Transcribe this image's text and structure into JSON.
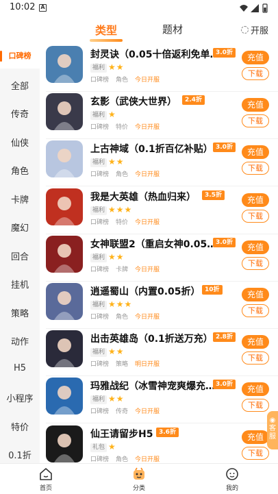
{
  "status_bar": {
    "time": "10:02",
    "notification_icon": "A"
  },
  "top_tabs": [
    {
      "label": "类型",
      "active": true
    },
    {
      "label": "题材",
      "active": false
    }
  ],
  "server_button": {
    "label": "开服",
    "icon": "refresh-ring-icon"
  },
  "sidebar": {
    "items": [
      {
        "label": "口碑榜",
        "active": true
      },
      {
        "label": "全部"
      },
      {
        "label": "传奇"
      },
      {
        "label": "仙侠"
      },
      {
        "label": "角色"
      },
      {
        "label": "卡牌"
      },
      {
        "label": "魔幻"
      },
      {
        "label": "回合"
      },
      {
        "label": "挂机"
      },
      {
        "label": "策略"
      },
      {
        "label": "动作"
      },
      {
        "label": "H5"
      },
      {
        "label": "小程序"
      },
      {
        "label": "特价"
      },
      {
        "label": "0.1折"
      }
    ]
  },
  "games": [
    {
      "name": "封灵诀（0.05十倍返利免单…",
      "discount": "3.0折",
      "badge": "福利",
      "stars": "★★",
      "rating": 1.5,
      "tags": [
        "口碑榜",
        "角色"
      ],
      "open": "今日开服",
      "charge_label": "充值",
      "download_label": "下载",
      "thumb_color": "#4a7fb0"
    },
    {
      "name": "玄影（武侠大世界）",
      "discount": "2.4折",
      "badge": "福利",
      "stars": "★",
      "rating": 0.5,
      "tags": [
        "口碑榜",
        "特价"
      ],
      "open": "今日开服",
      "charge_label": "充值",
      "download_label": "下载",
      "thumb_color": "#3a3a4a"
    },
    {
      "name": "上古神域（0.1折百亿补贴）",
      "discount": "3.0折",
      "badge": "福利",
      "stars": "★★",
      "rating": 1.5,
      "tags": [
        "口碑榜",
        "角色"
      ],
      "open": "今日开服",
      "charge_label": "充值",
      "download_label": "下载",
      "thumb_color": "#b8c6e0"
    },
    {
      "name": "我是大英雄（热血归来）",
      "discount": "3.5折",
      "badge": "福利",
      "stars": "★★★",
      "rating": 3,
      "tags": [
        "口碑榜",
        "特价"
      ],
      "open": "今日开服",
      "charge_label": "充值",
      "download_label": "下载",
      "thumb_color": "#c03020"
    },
    {
      "name": "女神联盟2（重启女神0.05…",
      "discount": "3.0折",
      "badge": "福利",
      "stars": "★★",
      "rating": 2,
      "tags": [
        "口碑榜",
        "卡牌"
      ],
      "open": "今日开服",
      "charge_label": "充值",
      "download_label": "下载",
      "thumb_color": "#8a2020"
    },
    {
      "name": "逍遥蜀山（内置0.05折）",
      "discount": "10折",
      "badge": "福利",
      "stars": "★★★",
      "rating": 3,
      "tags": [
        "口碑榜",
        "角色"
      ],
      "open": "今日开服",
      "charge_label": "充值",
      "download_label": "下载",
      "thumb_color": "#5a6a9a"
    },
    {
      "name": "出击英雄岛（0.1折送万充）",
      "discount": "2.8折",
      "badge": "福利",
      "stars": "★★",
      "rating": 2,
      "tags": [
        "口碑榜",
        "策略"
      ],
      "open": "明日开服",
      "charge_label": "充值",
      "download_label": "下载",
      "thumb_color": "#2a2a3a"
    },
    {
      "name": "玛雅战纪（冰雪神宠爽爆充…",
      "discount": "3.0折",
      "badge": "福利",
      "stars": "★★",
      "rating": 2,
      "tags": [
        "口碑榜",
        "传奇"
      ],
      "open": "今日开服",
      "charge_label": "充值",
      "download_label": "下载",
      "thumb_color": "#2a6ab0"
    },
    {
      "name": "仙王请留步H5",
      "discount": "3.6折",
      "badge": "礼包",
      "stars": "★",
      "rating": 1,
      "tags": [
        "口碑榜",
        "角色"
      ],
      "open": "今日开服",
      "charge_label": "充值",
      "download_label": "下载",
      "thumb_color": "#1a1a1a"
    }
  ],
  "service_button": {
    "label": "客服"
  },
  "bottom_nav": [
    {
      "label": "首页",
      "icon": "home-icon"
    },
    {
      "label": "分类",
      "icon": "category-icon",
      "active": true
    },
    {
      "label": "我的",
      "icon": "profile-icon"
    }
  ],
  "colors": {
    "accent": "#ff8a1a",
    "star": "#ffb21a"
  }
}
